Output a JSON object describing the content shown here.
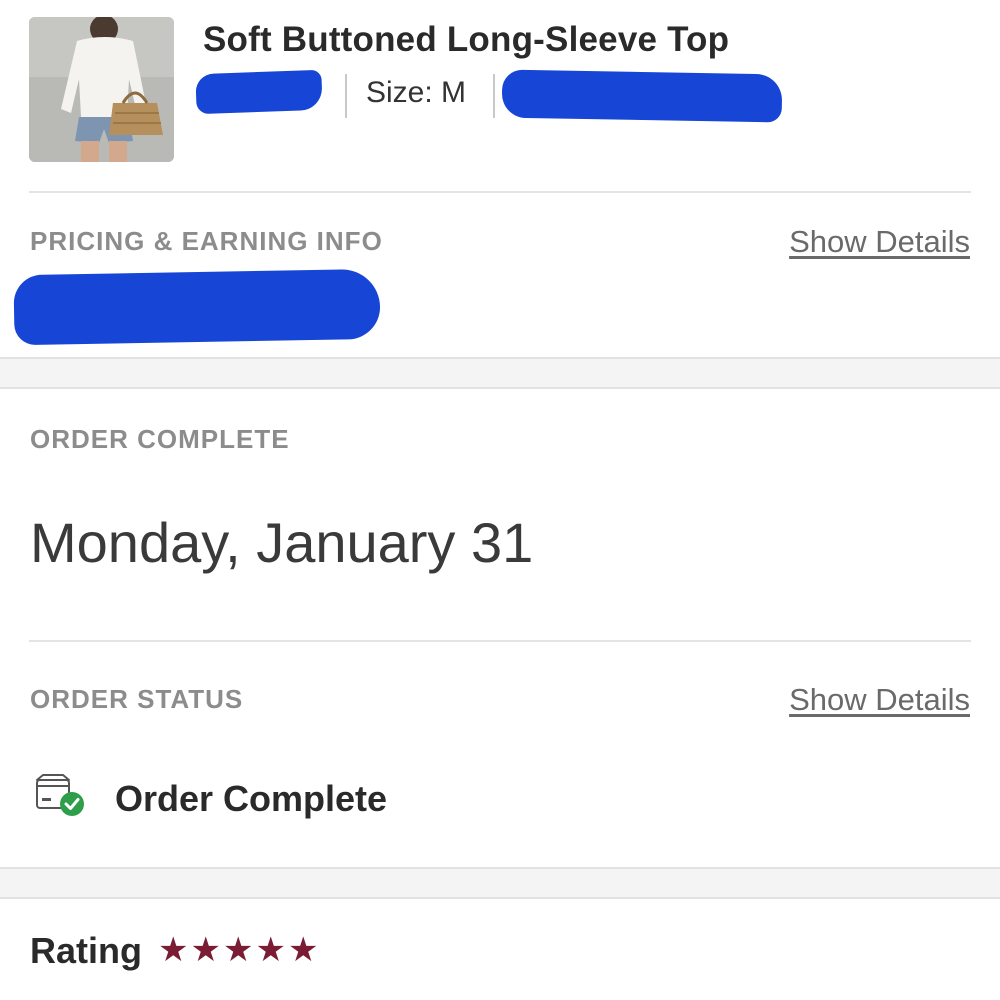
{
  "product": {
    "title": "Soft Buttoned Long-Sleeve Top",
    "size_label": "Size: M",
    "image_icon": "product-photo"
  },
  "pricing": {
    "heading": "PRICING & EARNING INFO",
    "details_link": "Show Details"
  },
  "order_complete": {
    "heading": "ORDER COMPLETE",
    "date": "Monday, January 31"
  },
  "order_status": {
    "heading": "ORDER STATUS",
    "details_link": "Show Details",
    "status": "Order Complete",
    "icon": "package-check-icon",
    "check_color": "#2e9e4a"
  },
  "rating": {
    "label": "Rating",
    "stars": 5,
    "star_color": "#7a1d34"
  },
  "colors": {
    "redaction": "#1746d6"
  }
}
